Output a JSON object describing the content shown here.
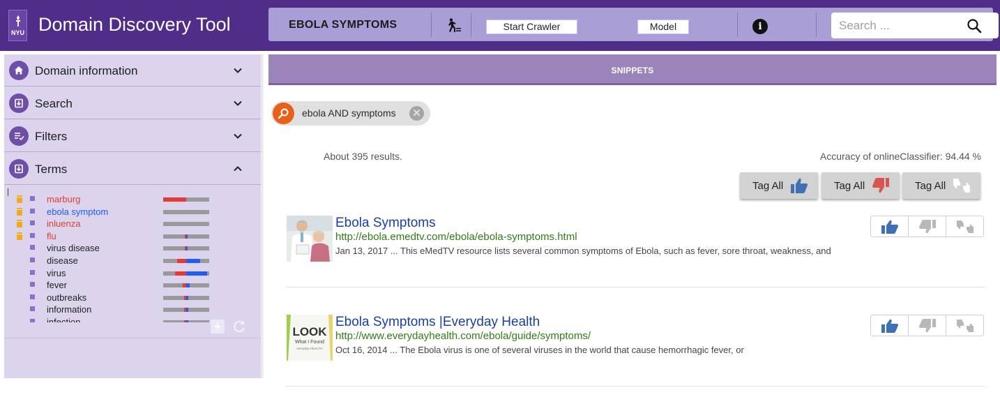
{
  "app": {
    "title": "Domain Discovery Tool",
    "logo_text": "NYU"
  },
  "toolbar": {
    "domain_name": "EBOLA SYMPTOMS",
    "start_crawler_label": "Start Crawler",
    "model_label": "Model",
    "info_glyph": "i",
    "search_placeholder": "Search ...",
    "search_value": ""
  },
  "sidebar": {
    "sections": [
      {
        "label": "Domain information",
        "icon": "home-icon",
        "expanded": false
      },
      {
        "label": "Search",
        "icon": "search-download-icon",
        "expanded": false
      },
      {
        "label": "Filters",
        "icon": "filter-list-icon",
        "expanded": false
      },
      {
        "label": "Terms",
        "icon": "terms-download-icon",
        "expanded": true
      }
    ],
    "terms": [
      {
        "text": "marburg",
        "pinned": true,
        "color": "#e53935",
        "relevant": 0.5,
        "irrelevant": 0.0
      },
      {
        "text": "ebola symptom",
        "pinned": true,
        "color": "#1e5ef5",
        "relevant": 0.0,
        "irrelevant": 0.0
      },
      {
        "text": "inluenza",
        "pinned": true,
        "color": "#e53935",
        "relevant": 0.0,
        "irrelevant": 0.0
      },
      {
        "text": "flu",
        "pinned": true,
        "color": "#e53935",
        "relevant": 0.03,
        "irrelevant": 0.03
      },
      {
        "text": "virus disease",
        "pinned": false,
        "color": "#222222",
        "relevant": 0.03,
        "irrelevant": 0.03
      },
      {
        "text": "disease",
        "pinned": false,
        "color": "#222222",
        "relevant": 0.2,
        "irrelevant": 0.3
      },
      {
        "text": "virus",
        "pinned": false,
        "color": "#222222",
        "relevant": 0.25,
        "irrelevant": 0.45
      },
      {
        "text": "fever",
        "pinned": false,
        "color": "#222222",
        "relevant": 0.08,
        "irrelevant": 0.08
      },
      {
        "text": "outbreaks",
        "pinned": false,
        "color": "#222222",
        "relevant": 0.04,
        "irrelevant": 0.04
      },
      {
        "text": "information",
        "pinned": false,
        "color": "#222222",
        "relevant": 0.05,
        "irrelevant": 0.05
      },
      {
        "text": "infection",
        "pinned": false,
        "color": "#222222",
        "relevant": 0.04,
        "irrelevant": 0.04
      }
    ],
    "add_term_glyph": "+",
    "refresh_icon": "refresh-icon"
  },
  "main": {
    "tab_label": "SNIPPETS",
    "query_chip": {
      "label": "ebola AND symptoms",
      "close_glyph": "✕"
    },
    "results_count": "About 395 results.",
    "accuracy": "Accuracy of onlineClassifier: 94.44 %",
    "tag_all_label": "Tag All",
    "results": [
      {
        "title": "Ebola Symptoms",
        "url": "http://ebola.emedtv.com/ebola/ebola-symptoms.html",
        "description": "Jan 13, 2017 ... This eMedTV resource lists several common symptoms of Ebola, such as fever, sore throat, weakness, and",
        "thumb": "doctor-patient-photo"
      },
      {
        "title": "Ebola Symptoms |Everyday Health",
        "url": "http://www.everydayhealth.com/ebola/guide/symptoms/",
        "description": "Oct 16, 2014 ... The Ebola virus is one of several viruses in the world that cause hemorrhagic fever, or",
        "thumb": "look-what-i-found-logo",
        "thumb_text": {
          "line1": "LOOK",
          "line2": "What I Found",
          "line3": "everyday HEALTH"
        }
      }
    ]
  },
  "colors": {
    "header_bg": "#4f2d88",
    "toolbar_bg": "#a99ed6",
    "sidebar_bg": "#dcd3ec",
    "tab_bg": "#9b84b9",
    "thumb_up": "#3f6fb5",
    "thumb_down_active": "#d9534f",
    "icon_gray": "#a0a0a0"
  }
}
